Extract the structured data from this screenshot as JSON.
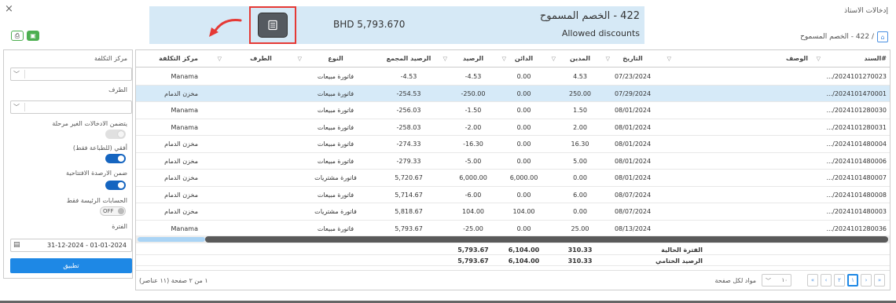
{
  "window": {
    "title": "إدخالات الاستاذ",
    "close": "×"
  },
  "breadcrumb": {
    "text": "/ 422 - الخصم المسموح"
  },
  "banner": {
    "title_ar": "422 - الخصم المسموح",
    "title_en": "Allowed discounts",
    "amount": "BHD 5,793.670"
  },
  "filters": {
    "cost_center_label": "مركز التكلفة",
    "party_label": "الطرف",
    "include_unposted_label": "يتضمن الادخالات الغير مرحلة",
    "horizontal_label": "أفقي (للطباعة فقط)",
    "opening_balances_label": "ضمن الارصدة الافتتاحية",
    "main_accounts_label": "الحسابات الرئيسة فقط",
    "main_accounts_value": "OFF",
    "period_label": "الفترة",
    "period_value": "31-12-2024 - 01-01-2024",
    "apply_label": "تطبيق"
  },
  "columns": {
    "serial": "السند#",
    "description": "الوصف",
    "date": "التاريخ",
    "debit": "المدين",
    "credit": "الدائن",
    "balance": "الرصيد",
    "cumulative": "الرصيد المجمع",
    "type": "النوع",
    "party": "الطرف",
    "cost_center": "مركز التكلفة"
  },
  "rows": [
    {
      "serial": ".../2024101270023",
      "date": "07/23/2024",
      "debit": "4.53",
      "credit": "0.00",
      "balance": "-4.53",
      "cumulative": "-4.53",
      "type": "فاتورة مبيعات",
      "cost_center": "Manama"
    },
    {
      "serial": ".../2024101470001",
      "date": "07/29/2024",
      "debit": "250.00",
      "credit": "0.00",
      "balance": "-250.00",
      "cumulative": "-254.53",
      "type": "فاتورة مبيعات",
      "cost_center": "مخزن الدمام"
    },
    {
      "serial": ".../2024101280030",
      "date": "08/01/2024",
      "debit": "1.50",
      "credit": "0.00",
      "balance": "-1.50",
      "cumulative": "-256.03",
      "type": "فاتورة مبيعات",
      "cost_center": "Manama"
    },
    {
      "serial": ".../2024101280031",
      "date": "08/01/2024",
      "debit": "2.00",
      "credit": "0.00",
      "balance": "-2.00",
      "cumulative": "-258.03",
      "type": "فاتورة مبيعات",
      "cost_center": "Manama"
    },
    {
      "serial": ".../2024101480004",
      "date": "08/01/2024",
      "debit": "16.30",
      "credit": "0.00",
      "balance": "-16.30",
      "cumulative": "-274.33",
      "type": "فاتورة مبيعات",
      "cost_center": "مخزن الدمام"
    },
    {
      "serial": ".../2024101480006",
      "date": "08/01/2024",
      "debit": "5.00",
      "credit": "0.00",
      "balance": "-5.00",
      "cumulative": "-279.33",
      "type": "فاتورة مبيعات",
      "cost_center": "مخزن الدمام"
    },
    {
      "serial": ".../2024101480007",
      "date": "08/01/2024",
      "debit": "0.00",
      "credit": "6,000.00",
      "balance": "6,000.00",
      "cumulative": "5,720.67",
      "type": "فاتورة مشتريات",
      "cost_center": "مخزن الدمام"
    },
    {
      "serial": ".../2024101480008",
      "date": "08/07/2024",
      "debit": "6.00",
      "credit": "0.00",
      "balance": "-6.00",
      "cumulative": "5,714.67",
      "type": "فاتورة مبيعات",
      "cost_center": "مخزن الدمام"
    },
    {
      "serial": ".../2024101480003",
      "date": "08/07/2024",
      "debit": "0.00",
      "credit": "104.00",
      "balance": "104.00",
      "cumulative": "5,818.67",
      "type": "فاتورة مشتريات",
      "cost_center": "مخزن الدمام"
    },
    {
      "serial": ".../2024101280036",
      "date": "08/13/2024",
      "debit": "25.00",
      "credit": "0.00",
      "balance": "-25.00",
      "cumulative": "5,793.67",
      "type": "فاتورة مبيعات",
      "cost_center": "Manama"
    }
  ],
  "totals": [
    {
      "label": "الفترة الحالية",
      "debit": "310.33",
      "credit": "6,104.00",
      "balance": "5,793.67"
    },
    {
      "label": "الرصيد الختامي",
      "debit": "310.33",
      "credit": "6,104.00",
      "balance": "5,793.67"
    }
  ],
  "pager": {
    "info": "١ من ٢ صفحة (١١ عناصر)",
    "size_label": "مواد لكل صفحة",
    "size_value": "١٠",
    "pages": [
      "«",
      "‹",
      "٢",
      "١",
      "›",
      "»"
    ],
    "active_page": "١"
  },
  "colors": {
    "accent": "#1e88e5",
    "banner": "#d6e9f6",
    "selected_row": "#d6eaf8",
    "toggle_on": "#1565c0",
    "export_green": "#4caf50",
    "highlight_box": "#e53935"
  }
}
